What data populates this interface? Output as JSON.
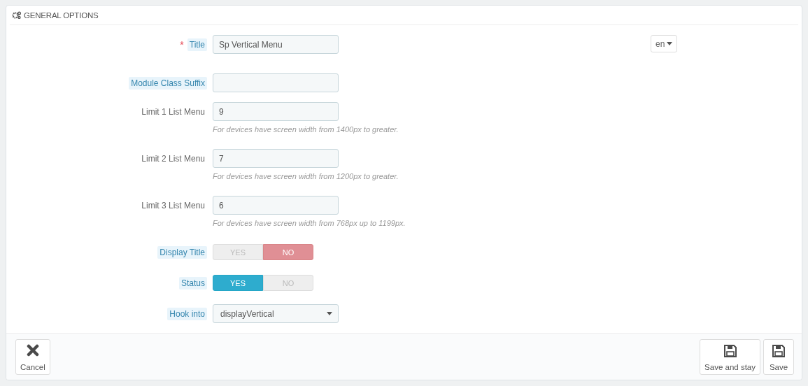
{
  "panel": {
    "title": "GENERAL OPTIONS"
  },
  "fields": [
    {
      "kind": "text",
      "label": "Title",
      "required_mark": "*",
      "hint": true,
      "value": "Sp Vertical Menu",
      "language": "en"
    },
    {
      "kind": "text",
      "label": "Module Class Suffix",
      "hint": true
    },
    {
      "kind": "text",
      "label": "Limit 1 List Menu",
      "hint": false,
      "value": "9",
      "help": "For devices have screen width from 1400px to greater."
    },
    {
      "kind": "text",
      "label": "Limit 2 List Menu",
      "hint": false,
      "value": "7",
      "help": "For devices have screen width from 1200px to greater."
    },
    {
      "kind": "text",
      "label": "Limit 3 List Menu",
      "hint": false,
      "value": "6",
      "help": "For devices have screen width from 768px up to 1199px."
    },
    {
      "kind": "switch",
      "label": "Display Title",
      "hint": true,
      "options": [
        {
          "label": "YES",
          "selected": false
        },
        {
          "label": "NO",
          "selected": true
        }
      ]
    },
    {
      "kind": "switch",
      "label": "Status",
      "hint": true,
      "options": [
        {
          "label": "YES",
          "selected": true
        },
        {
          "label": "NO",
          "selected": false
        }
      ]
    },
    {
      "kind": "select",
      "label": "Hook into",
      "hint": true,
      "value": "displayVertical"
    }
  ],
  "footer": {
    "left": [
      {
        "kind": "cancel",
        "label": "Cancel"
      }
    ],
    "right": [
      {
        "kind": "save",
        "label": "Save and stay"
      },
      {
        "kind": "save",
        "label": "Save"
      }
    ]
  }
}
